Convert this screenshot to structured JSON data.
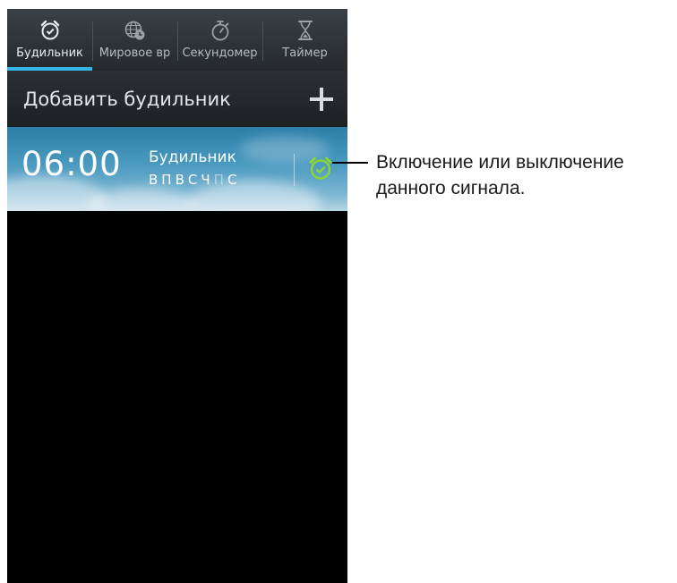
{
  "tabs": [
    {
      "label": "Будильник",
      "icon": "alarm-clock-icon",
      "active": true
    },
    {
      "label": "Мировое вр",
      "icon": "globe-clock-icon",
      "active": false
    },
    {
      "label": "Секундомер",
      "icon": "stopwatch-icon",
      "active": false
    },
    {
      "label": "Таймер",
      "icon": "hourglass-icon",
      "active": false
    }
  ],
  "add_alarm": {
    "label": "Добавить будильник",
    "icon": "plus-icon"
  },
  "alarm": {
    "time": "06:00",
    "name": "Будильник",
    "days": [
      "В",
      "П",
      "В",
      "С",
      "Ч",
      "П",
      "С"
    ],
    "days_active": [
      true,
      true,
      true,
      true,
      true,
      false,
      true
    ],
    "toggle_icon": "alarm-clock-icon",
    "toggle_color": "#8bd630"
  },
  "callout": {
    "line1": "Включение или выключение",
    "line2": "данного сигнала."
  },
  "colors": {
    "accent": "#33b5e5"
  }
}
